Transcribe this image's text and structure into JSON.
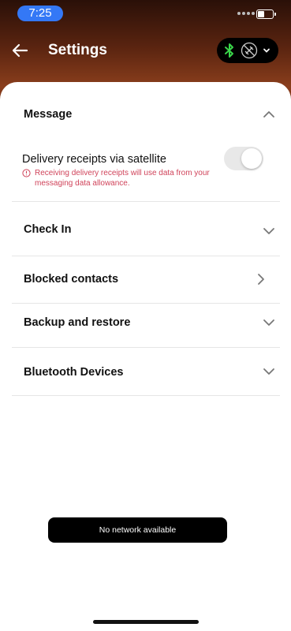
{
  "status_bar": {
    "time": "7:25"
  },
  "header": {
    "title": "Settings"
  },
  "colors": {
    "accent": "#3478f6",
    "warning": "#d0435a",
    "bluetooth": "#3ad64a"
  },
  "icons": {
    "back": "arrow-left-icon",
    "bluetooth": "bluetooth-icon",
    "satellite": "satellite-icon",
    "dropdown": "chevron-down-icon"
  },
  "sections": {
    "message": {
      "label": "Message",
      "delivery_receipts": {
        "label": "Delivery receipts via satellite",
        "warning": "Receiving delivery receipts will use data from your messaging data allowance.",
        "toggle_on": false
      }
    },
    "check_in": {
      "label": "Check In"
    },
    "blocked_contacts": {
      "label": "Blocked contacts"
    },
    "backup_restore": {
      "label": "Backup and restore"
    },
    "bluetooth_devices": {
      "label": "Bluetooth Devices"
    }
  },
  "toast": {
    "text": "No network available"
  }
}
